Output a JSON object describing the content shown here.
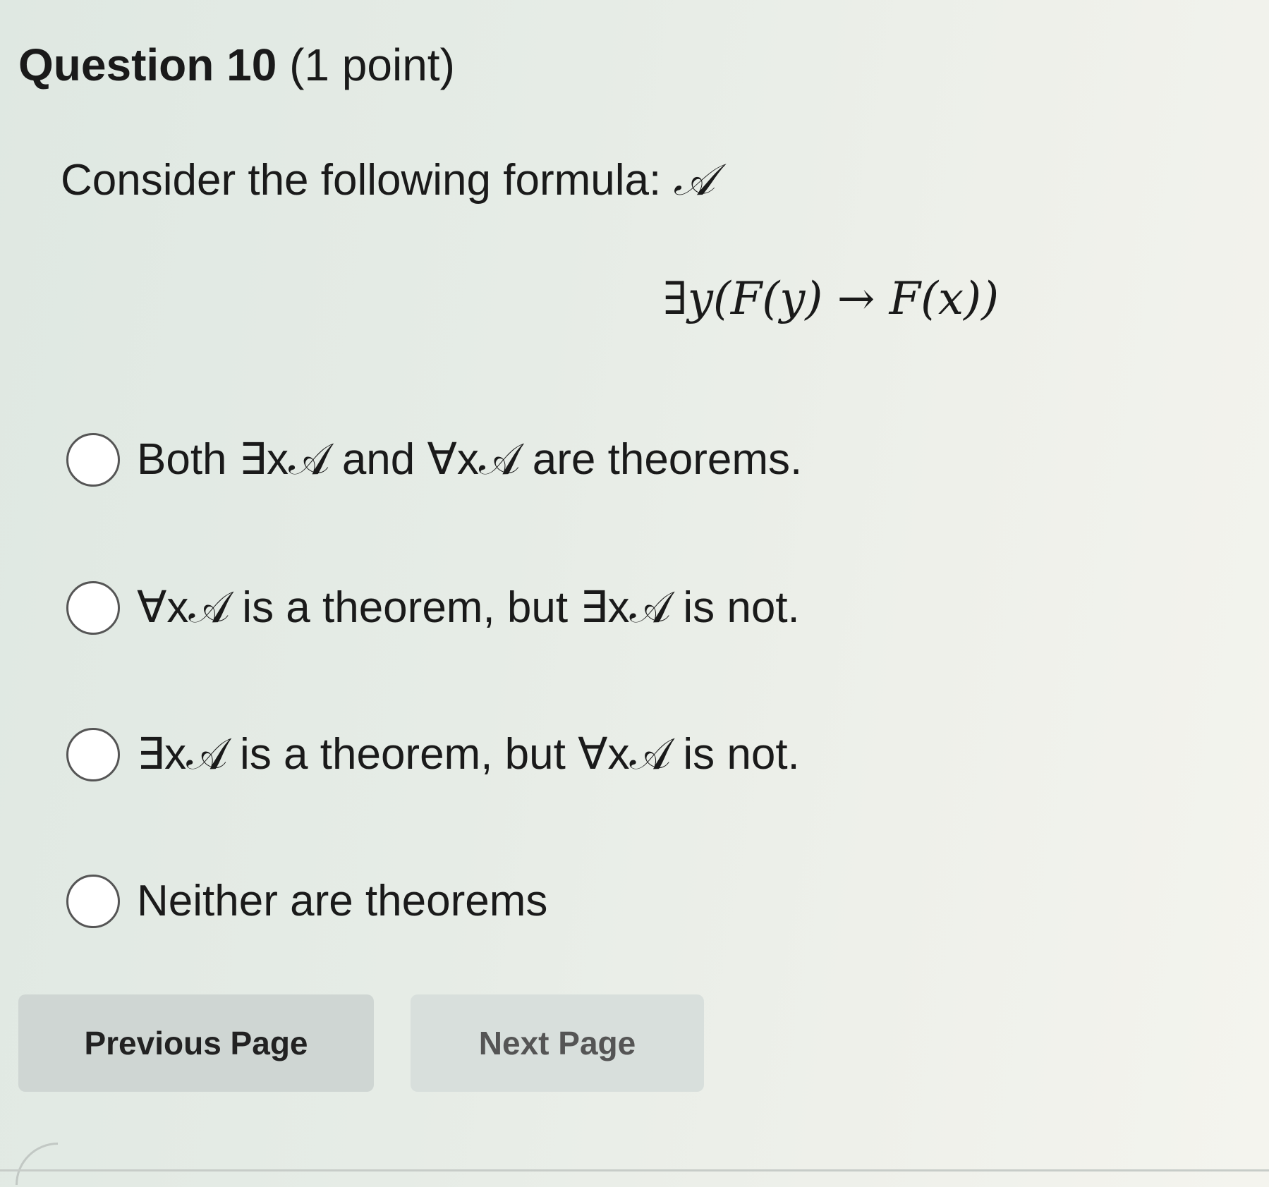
{
  "question": {
    "title": "Question 10",
    "points": "(1 point)"
  },
  "prompt": {
    "text": "Consider the following formula: ",
    "formula_name": "𝒜"
  },
  "formula": "∃y(F(y) → F(x))",
  "options": [
    {
      "label": "Both ∃x𝒜 and ∀x𝒜 are theorems."
    },
    {
      "label": "∀x𝒜 is a theorem, but ∃x𝒜 is not."
    },
    {
      "label": "∃x𝒜 is a theorem, but ∀x𝒜 is not."
    },
    {
      "label": "Neither are theorems"
    }
  ],
  "nav": {
    "previous_label": "Previous Page",
    "next_label": "Next Page"
  }
}
